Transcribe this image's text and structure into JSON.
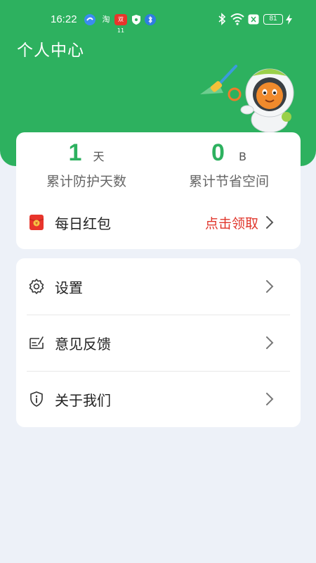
{
  "status_bar": {
    "time": "16:22",
    "app_badges": [
      "淘",
      "双11"
    ],
    "battery": "81"
  },
  "header": {
    "title": "个人中心"
  },
  "stats": {
    "protect_days_value": "1",
    "protect_days_unit": "天",
    "protect_days_label": "累计防护天数",
    "saved_space_value": "0",
    "saved_space_unit": "B",
    "saved_space_label": "累计节省空间"
  },
  "red_packet": {
    "label": "每日红包",
    "action": "点击领取",
    "icon": "red-envelope-icon"
  },
  "menu": {
    "items": [
      {
        "label": "设置",
        "icon": "gear-icon"
      },
      {
        "label": "意见反馈",
        "icon": "feedback-icon"
      },
      {
        "label": "关于我们",
        "icon": "info-shield-icon"
      }
    ]
  },
  "colors": {
    "brand_green": "#2db15f",
    "action_red": "#e0352b",
    "page_bg": "#edf1f8"
  }
}
